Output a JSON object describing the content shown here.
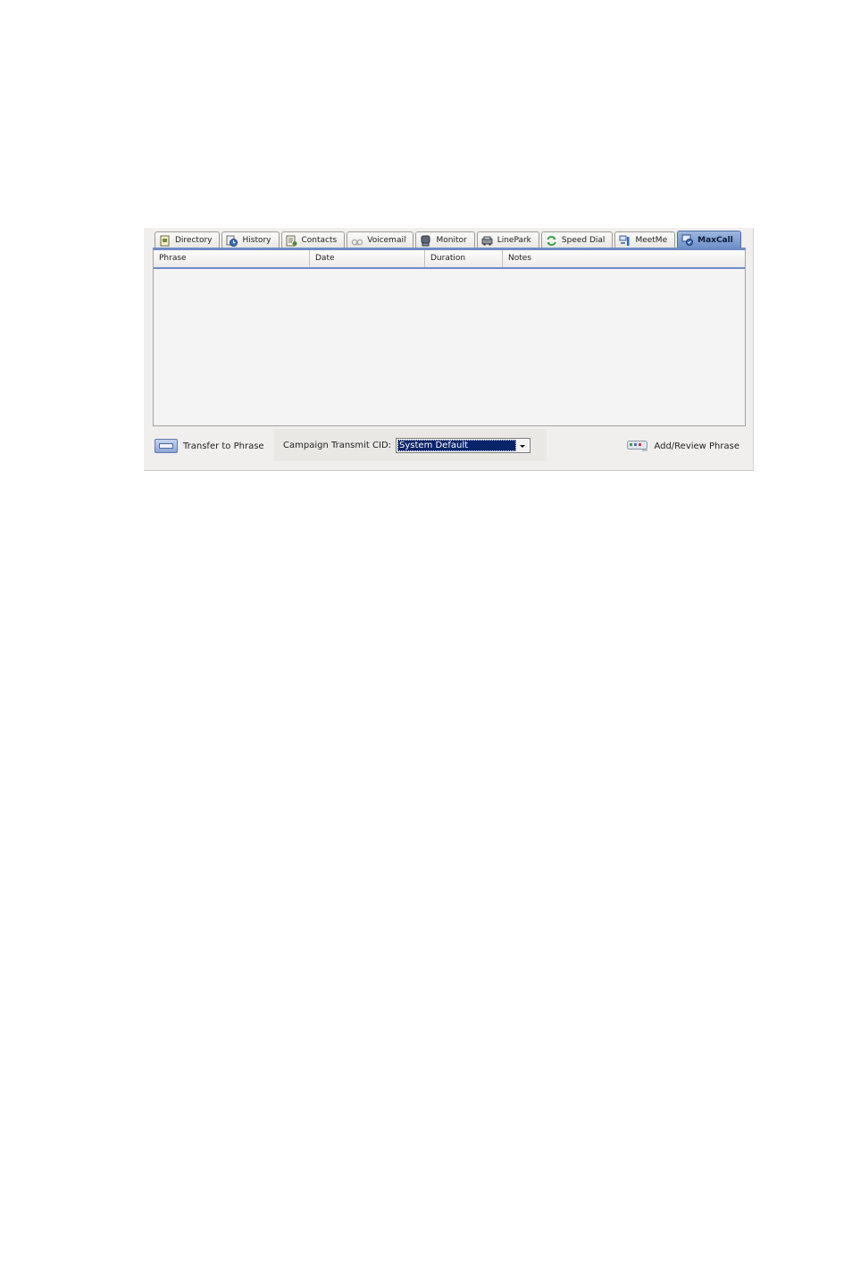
{
  "tabs": [
    {
      "label": "Directory",
      "icon": "directory-icon",
      "active": false
    },
    {
      "label": "History",
      "icon": "history-icon",
      "active": false
    },
    {
      "label": "Contacts",
      "icon": "contacts-icon",
      "active": false
    },
    {
      "label": "Voicemail",
      "icon": "voicemail-icon",
      "active": false
    },
    {
      "label": "Monitor",
      "icon": "monitor-icon",
      "active": false
    },
    {
      "label": "LinePark",
      "icon": "linepark-icon",
      "active": false
    },
    {
      "label": "Speed Dial",
      "icon": "speed-dial-icon",
      "active": false
    },
    {
      "label": "MeetMe",
      "icon": "meetme-icon",
      "active": false
    },
    {
      "label": "MaxCall",
      "icon": "maxcall-icon",
      "active": true
    }
  ],
  "table": {
    "columns": [
      "Phrase",
      "Date",
      "Duration",
      "Notes"
    ],
    "rows": []
  },
  "bottom_bar": {
    "transfer_label": "Transfer to Phrase",
    "cid_label": "Campaign Transmit CID:",
    "cid_value": "System Default",
    "add_review_label": "Add/Review Phrase"
  },
  "colors": {
    "accent": "#6e8cc8",
    "selection": "#0a246a",
    "active_tab": "#7f9dd2"
  }
}
